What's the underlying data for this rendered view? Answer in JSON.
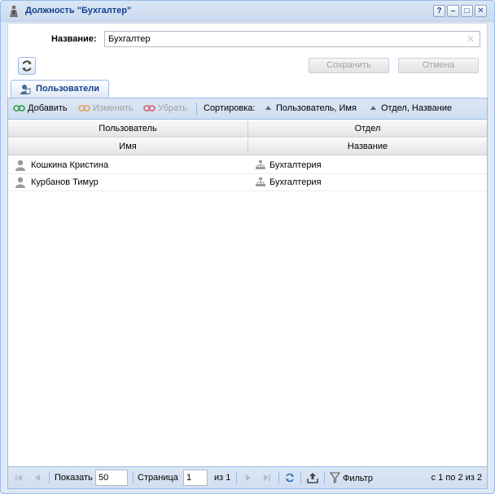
{
  "window": {
    "title": "Должность \"Бухгалтер\"",
    "tools": [
      "?",
      "–",
      "□",
      "✕"
    ]
  },
  "form": {
    "name_label": "Название:",
    "name_value": "Бухгалтер",
    "save_label": "Сохранить",
    "cancel_label": "Отмена"
  },
  "tab": {
    "label": "Пользователи"
  },
  "toolbar": {
    "add_label": "Добавить",
    "edit_label": "Изменить",
    "remove_label": "Убрать",
    "sort_label": "Сортировка:",
    "sort1_label": "Пользователь, Имя",
    "sort2_label": "Отдел, Название"
  },
  "grid": {
    "group_headers": [
      "Пользователь",
      "Отдел"
    ],
    "column_headers": [
      "Имя",
      "Название"
    ],
    "rows": [
      {
        "user": "Кошкина Кристина",
        "dept": "Бухгалтерия"
      },
      {
        "user": "Курбанов Тимур",
        "dept": "Бухгалтерия"
      }
    ]
  },
  "pager": {
    "show_label": "Показать",
    "page_size": "50",
    "page_label": "Страница",
    "page_value": "1",
    "of_label": "из 1",
    "filter_label": "Фильтр",
    "summary": "с 1 по 2 из 2"
  }
}
